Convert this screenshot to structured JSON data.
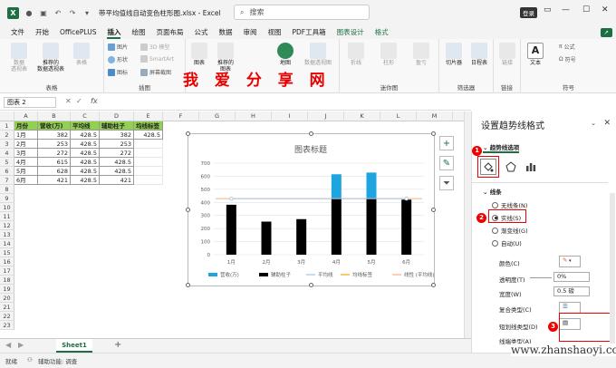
{
  "title_bar": {
    "title": "带平均值线自动变色柱形图.xlsx  -  Excel",
    "search_placeholder": "搜索",
    "login": "登录"
  },
  "menu": [
    "文件",
    "开始",
    "OfficePLUS",
    "插入",
    "绘图",
    "页面布局",
    "公式",
    "数据",
    "审阅",
    "视图",
    "PDF工具箱",
    "图表设计",
    "格式"
  ],
  "menu_active": "插入",
  "ribbon": {
    "groups": [
      "表格",
      "插图",
      "迷你图",
      "筛选器",
      "链接",
      "符号"
    ],
    "buttons": {
      "pivot": "数据\n透视表",
      "rec_pivot": "推荐的\n数据透视表",
      "table": "表格",
      "picture": "图片",
      "shapes": "形状",
      "icons": "图标",
      "models": "3D 模型",
      "smartart": "SmartArt",
      "screenshot": "屏幕截图",
      "addin": "图表",
      "rec_chart": "推荐的\n图表",
      "map": "地图",
      "pivot_chart": "数据透视图",
      "line": "折线",
      "column": "柱形",
      "winloss": "盈亏",
      "slicer": "切片器",
      "timeline": "日程表",
      "link": "链接",
      "text": "文本",
      "equation": "公式",
      "symbol": "符号"
    }
  },
  "watermark": {
    "cn": "我 爱 分 享 网",
    "url": "www.zhanshaoyi.com"
  },
  "formula_bar": {
    "name_box": "图表 2",
    "fx": "fx"
  },
  "sheet": {
    "columns": [
      "A",
      "B",
      "C",
      "D",
      "E",
      "F",
      "G",
      "H",
      "I",
      "J",
      "K",
      "L",
      "M",
      "N"
    ],
    "headers": [
      "月份",
      "营收(万)",
      "平均线",
      "辅助柱子",
      "均线标签"
    ],
    "rows": [
      [
        "1月",
        "382",
        "428.5",
        "382",
        "428.5"
      ],
      [
        "2月",
        "253",
        "428.5",
        "253",
        ""
      ],
      [
        "3月",
        "272",
        "428.5",
        "272",
        ""
      ],
      [
        "4月",
        "615",
        "428.5",
        "428.5",
        ""
      ],
      [
        "5月",
        "628",
        "428.5",
        "428.5",
        ""
      ],
      [
        "6月",
        "421",
        "428.5",
        "421",
        ""
      ]
    ],
    "row_numbers": [
      "1",
      "2",
      "3",
      "4",
      "5",
      "6",
      "7",
      "8",
      "9",
      "10",
      "11",
      "12",
      "13",
      "14",
      "15",
      "16",
      "17",
      "18",
      "19",
      "20",
      "21",
      "22",
      "23"
    ],
    "tab": "Sheet1",
    "add_tab": "+"
  },
  "chart_data": {
    "type": "bar",
    "title": "图表标题",
    "categories": [
      "1月",
      "2月",
      "3月",
      "4月",
      "5月",
      "6月"
    ],
    "stacked": true,
    "ylim": [
      0,
      700
    ],
    "yticks": [
      "0",
      "100",
      "200",
      "300",
      "400",
      "500",
      "600",
      "700"
    ],
    "series": [
      {
        "name": "营收(万)",
        "values": [
          0,
          0,
          0,
          186.5,
          199.5,
          0
        ],
        "color": "#1ea5e0"
      },
      {
        "name": "辅助柱子",
        "values": [
          382,
          253,
          272,
          428.5,
          428.5,
          421
        ],
        "color": "#000000"
      },
      {
        "name": "平均线",
        "values": [
          428.5,
          428.5,
          428.5,
          428.5,
          428.5,
          428.5
        ],
        "color": "#9dc3e6"
      },
      {
        "name": "均线标签",
        "values": [
          428.5
        ],
        "color": "#f2a900"
      },
      {
        "name": "线性 (平均线)",
        "color": "#f4b183"
      }
    ],
    "legend_position": "bottom",
    "gridlines": true
  },
  "pane": {
    "title": "设置趋势线格式",
    "subtitle": "趋势线选项",
    "section": "线条",
    "options": [
      "无线条(N)",
      "实线(S)",
      "渐变线(G)",
      "自动(U)"
    ],
    "selected": "实线(S)",
    "props": {
      "color": "颜色(C)",
      "transparency": "透明度(T)",
      "transparency_val": "0%",
      "width": "宽度(W)",
      "width_val": "0.5 磅",
      "compound": "复合类型(C)",
      "dash": "短划线类型(D)",
      "cap": "线端类型(A)"
    },
    "badges": [
      "1",
      "2",
      "3"
    ]
  },
  "status": {
    "ready": "就绪",
    "accessibility": "辅助功能: 调查"
  },
  "colors": {
    "accent": "#1d6f42",
    "header_green": "#92d050",
    "annotation_red": "#e00000"
  }
}
